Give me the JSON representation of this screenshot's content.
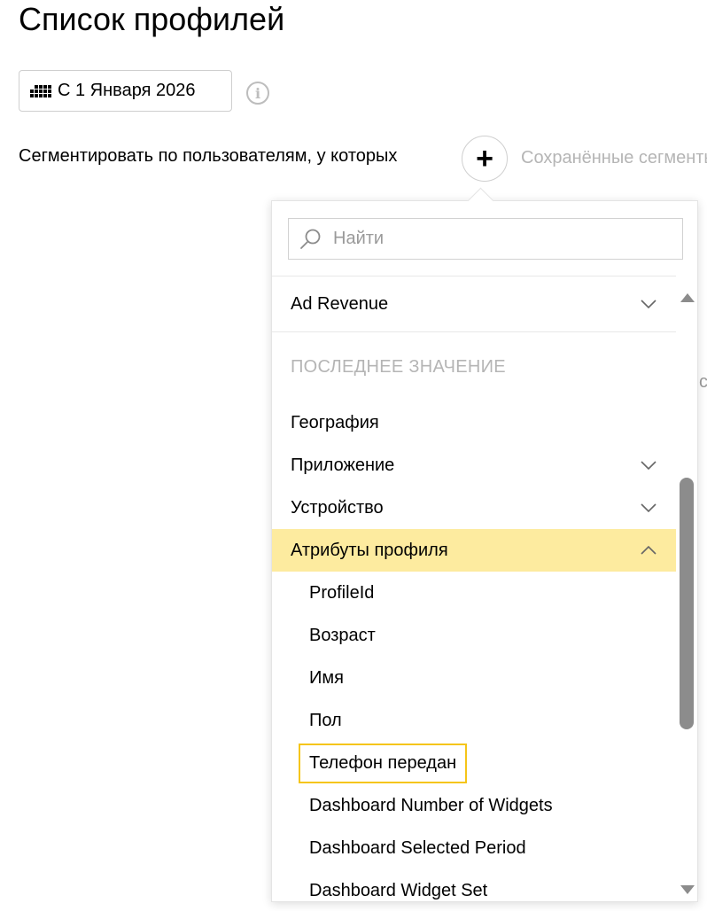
{
  "page": {
    "title": "Список профилей"
  },
  "toolbar": {
    "date_label": "С 1 Января 2026",
    "info_glyph": "i"
  },
  "segment": {
    "label": "Сегментировать по пользователям, у которых",
    "add_glyph": "+",
    "saved_label": "Сохранённые сегменты",
    "right_edge_glyph": "с"
  },
  "dropdown": {
    "search_placeholder": "Найти",
    "ad_revenue": "Ad Revenue",
    "section_header": "ПОСЛЕДНЕЕ ЗНАЧЕНИЕ",
    "items": [
      {
        "label": "География"
      },
      {
        "label": "Приложение"
      },
      {
        "label": "Устройство"
      },
      {
        "label": "Атрибуты профиля"
      }
    ],
    "children": [
      {
        "label": "ProfileId"
      },
      {
        "label": "Возраст"
      },
      {
        "label": "Имя"
      },
      {
        "label": "Пол"
      },
      {
        "label": "Телефон передан"
      },
      {
        "label": "Dashboard Number of Widgets"
      },
      {
        "label": "Dashboard Selected Period"
      },
      {
        "label": "Dashboard Widget Set"
      }
    ]
  },
  "colors": {
    "selected_bg": "#fdeb9f",
    "highlight_border": "#f5c518",
    "muted_text": "#b5b5b5",
    "scrollbar": "#8c8c8c"
  },
  "icons": {
    "calendar": "calendar-grid-icon",
    "info": "info-icon",
    "add": "plus-icon",
    "search": "search-icon",
    "expand": "chevron-down-icon",
    "collapse": "chevron-up-icon"
  }
}
